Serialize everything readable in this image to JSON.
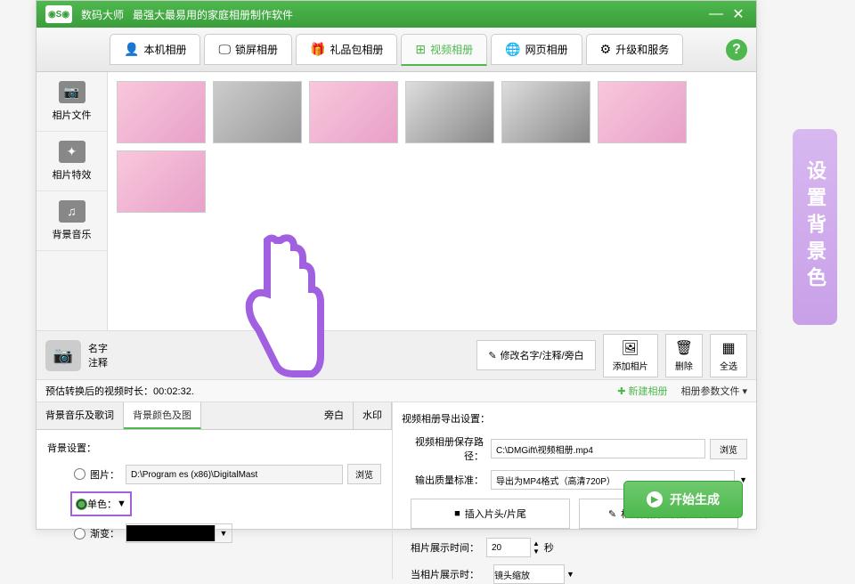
{
  "title_bar": {
    "app_name": "数码大师",
    "tagline": "最强大最易用的家庭相册制作软件",
    "logo": "◉S◉"
  },
  "top_tabs": {
    "tab1": "本机相册",
    "tab2": "锁屏相册",
    "tab3": "礼品包相册",
    "tab4": "视频相册",
    "tab5": "网页相册",
    "tab6": "升级和服务",
    "help": "?"
  },
  "side_nav": {
    "item1": "相片文件",
    "item2": "相片特效",
    "item3": "背景音乐"
  },
  "action_bar": {
    "name_label": "名字",
    "note_label": "注释",
    "modify_btn": "修改名字/注释/旁白",
    "add_btn": "添加相片",
    "delete_btn": "删除",
    "select_all_btn": "全选"
  },
  "status_bar": {
    "estimate": "预估转换后的视频时长：00:02:32.",
    "new_album": "新建相册",
    "params_file": "相册参数文件"
  },
  "sub_tabs": {
    "st1": "背景音乐及歌词",
    "st2": "背景颜色及图",
    "st3": "旁白",
    "st4": "水印"
  },
  "bg_panel": {
    "section": "背景设置：",
    "radio_image": "图片：",
    "radio_color": "单色：",
    "radio_gradient": "渐变：",
    "image_path": "D:\\Program    es (x86)\\DigitalMast",
    "browse": "浏览"
  },
  "export_panel": {
    "section": "视频相册导出设置：",
    "save_path_label": "视频相册保存路径：",
    "save_path": "C:\\DMGift\\视频相册.mp4",
    "quality_label": "输出质量标准：",
    "quality_value": "导出为MP4格式（高清720P）",
    "browse": "浏览",
    "insert_head": "插入片头/片尾",
    "insert_clip": "相片间插入视频短片",
    "display_time_label": "相片展示时间：",
    "display_time_value": "20",
    "display_time_unit": "秒",
    "transition_label": "当相片展示时：",
    "transition_value": "镜头缩放",
    "start_btn": "开始生成"
  },
  "side_label": "设置背景色"
}
